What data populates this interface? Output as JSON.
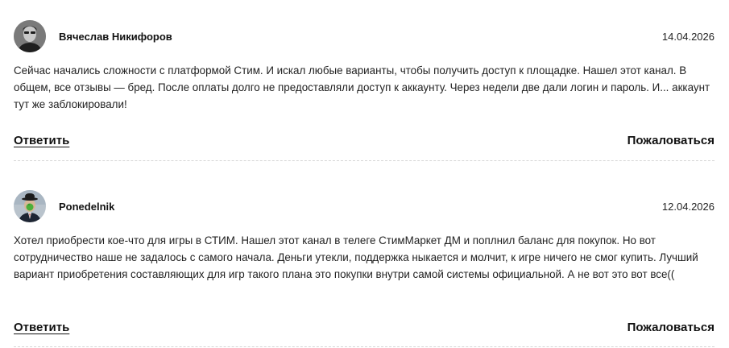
{
  "comments": [
    {
      "author": "Вячеслав Никифоров",
      "date": "14.04.2026",
      "text": "Сейчас начались сложности с платформой Стим. И искал любые варианты, чтобы получить доступ к площадке. Нашел этот канал. В общем, все отзывы — бред. После оплаты долго не предоставляли доступ к аккаунту. Через недели две дали логин и пароль. И... аккаунт тут же заблокировали!",
      "reply_label": "Ответить",
      "complain_label": "Пожаловаться"
    },
    {
      "author": "Ponedelnik",
      "date": "12.04.2026",
      "text": "Хотел приобрести кое-что для игры в СТИМ. Нашел этот канал в телеге СтимМаркет ДМ и поплнил баланс для покупок. Но вот сотрудничество наше не задалось с самого начала. Деньги утекли, поддержка ныкается и молчит, к игре ничего не смог купить. Лучший вариант приобретения составляющих для игр такого плана это покупки внутри самой системы официальной. А не вот это вот все((",
      "reply_label": "Ответить",
      "complain_label": "Пожаловаться"
    }
  ]
}
